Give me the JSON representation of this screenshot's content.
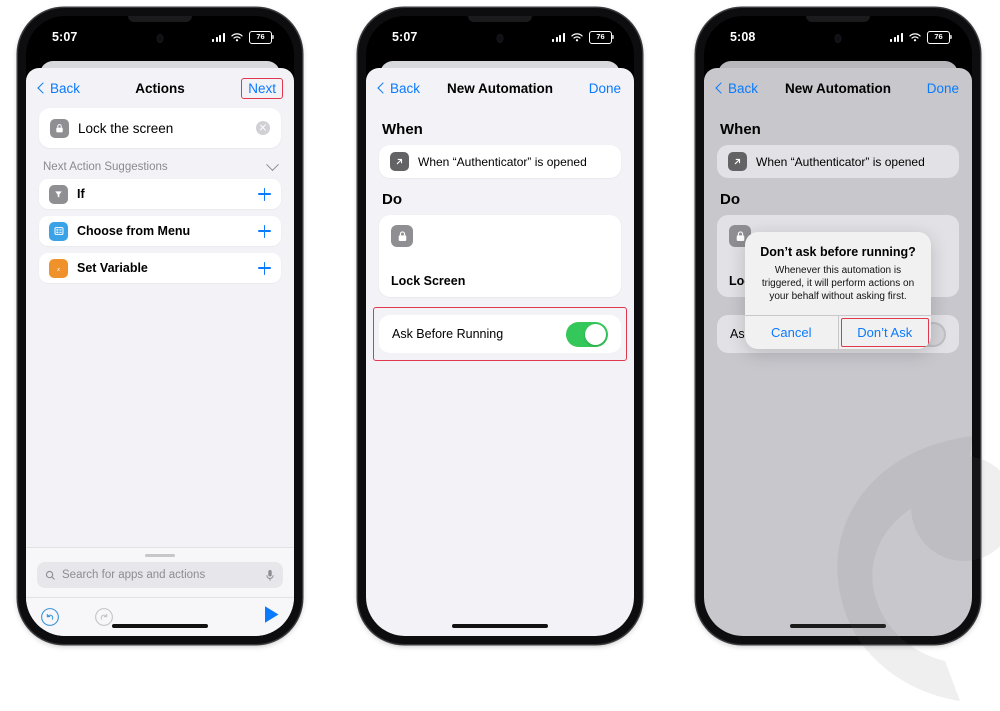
{
  "phones": [
    {
      "id": "phone-1",
      "status": {
        "time": "5:07",
        "battery": "76",
        "signal_icon": "cellular-bars-icon",
        "wifi_icon": "wifi-icon",
        "battery_icon": "battery-icon"
      },
      "nav": {
        "back_label": "Back",
        "title": "Actions",
        "right_label": "Next",
        "right_highlighted": true
      },
      "action": {
        "label": "Lock the screen",
        "icon": "lock-icon",
        "clear_icon": "clear-circle-icon"
      },
      "suggestions_header": {
        "label": "Next Action Suggestions",
        "chevron_icon": "chevron-down-icon"
      },
      "suggestions": [
        {
          "label": "If",
          "icon": "filter-icon",
          "add_icon": "plus-icon"
        },
        {
          "label": "Choose from Menu",
          "icon": "menu-list-icon",
          "add_icon": "plus-icon"
        },
        {
          "label": "Set Variable",
          "icon": "variable-icon",
          "add_icon": "plus-icon"
        }
      ],
      "search": {
        "placeholder": "Search for apps and actions",
        "search_icon": "search-icon",
        "mic_icon": "microphone-icon"
      },
      "toolbar": {
        "undo_icon": "undo-icon",
        "redo_icon": "redo-icon",
        "play_icon": "play-icon"
      }
    },
    {
      "id": "phone-2",
      "status": {
        "time": "5:07",
        "battery": "76"
      },
      "nav": {
        "back_label": "Back",
        "title": "New Automation",
        "right_label": "Done",
        "right_highlighted": false
      },
      "when": {
        "section_label": "When",
        "trigger_label": "When “Authenticator” is opened",
        "icon": "app-open-arrow-icon"
      },
      "do": {
        "section_label": "Do",
        "action_label": "Lock Screen",
        "icon": "lock-icon"
      },
      "ask": {
        "label": "Ask Before Running",
        "toggle_on": true,
        "highlighted": true
      }
    },
    {
      "id": "phone-3",
      "status": {
        "time": "5:08",
        "battery": "76"
      },
      "nav": {
        "back_label": "Back",
        "title": "New Automation",
        "right_label": "Done",
        "right_highlighted": false
      },
      "when": {
        "section_label": "When",
        "trigger_label": "When “Authenticator” is opened",
        "icon": "app-open-arrow-icon"
      },
      "do": {
        "section_label": "Do",
        "action_label": "Lock Screen",
        "icon": "lock-icon"
      },
      "ask": {
        "label": "Ask Before Running",
        "toggle_on": false,
        "highlighted": false
      },
      "alert": {
        "title": "Don’t ask before running?",
        "message": "Whenever this automation is triggered, it will perform actions on your behalf without asking first.",
        "cancel_label": "Cancel",
        "confirm_label": "Don’t Ask",
        "confirm_highlighted": true
      }
    }
  ],
  "colors": {
    "accent_blue": "#0a7aff",
    "highlight_red": "#e0384f",
    "toggle_green": "#34c759",
    "sheet_bg": "#f2f2f7",
    "sheet_dim_bg": "#c7c7cc"
  }
}
